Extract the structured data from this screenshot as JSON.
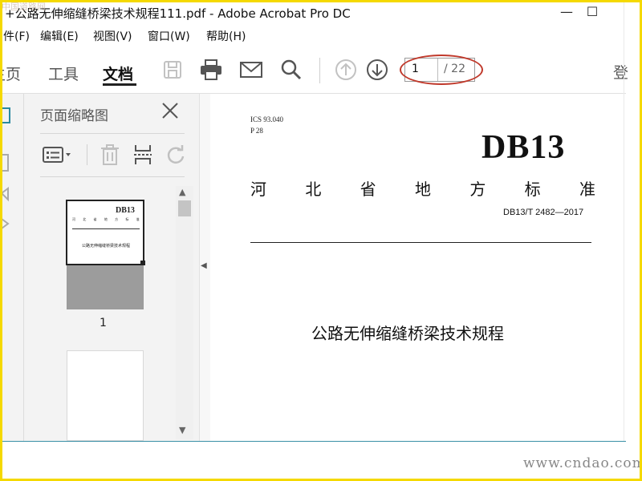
{
  "window": {
    "title": "+公路无伸缩缝桥梁技术规程111.pdf - Adobe Acrobat Pro DC",
    "minimize": "—",
    "maximize": "☐",
    "corner_watermark": "中国道路网"
  },
  "menu": {
    "items": [
      "件(F)",
      "编辑(E)",
      "视图(V)",
      "窗口(W)",
      "帮助(H)"
    ]
  },
  "toolbar": {
    "tabs": [
      "主页",
      "工具",
      "文档"
    ],
    "active_tab": "文档",
    "page_current": "1",
    "page_total": "/ 22",
    "sign_in": "登"
  },
  "panel": {
    "title": "页面缩略图",
    "thumb_label": "1",
    "thumb1_lines": {
      "header": "DB13",
      "subtitle": "河 北 省 地 方 标 准",
      "title": "公路无伸缩缝桥梁技术规程"
    }
  },
  "document": {
    "ics": "ICS 93.040",
    "p_code": "P 28",
    "db_code": "DB13",
    "standard_type_chars": [
      "河",
      "北",
      "省",
      "地",
      "方",
      "标",
      "准"
    ],
    "standard_number": "DB13/T 2482—2017",
    "title": "公路无伸缩缝桥梁技术规程"
  },
  "watermark": "www.cndao.com",
  "colors": {
    "frame": "#f5d900",
    "highlight_ellipse": "#c0392b",
    "accent_teal": "#3a8fa6"
  }
}
